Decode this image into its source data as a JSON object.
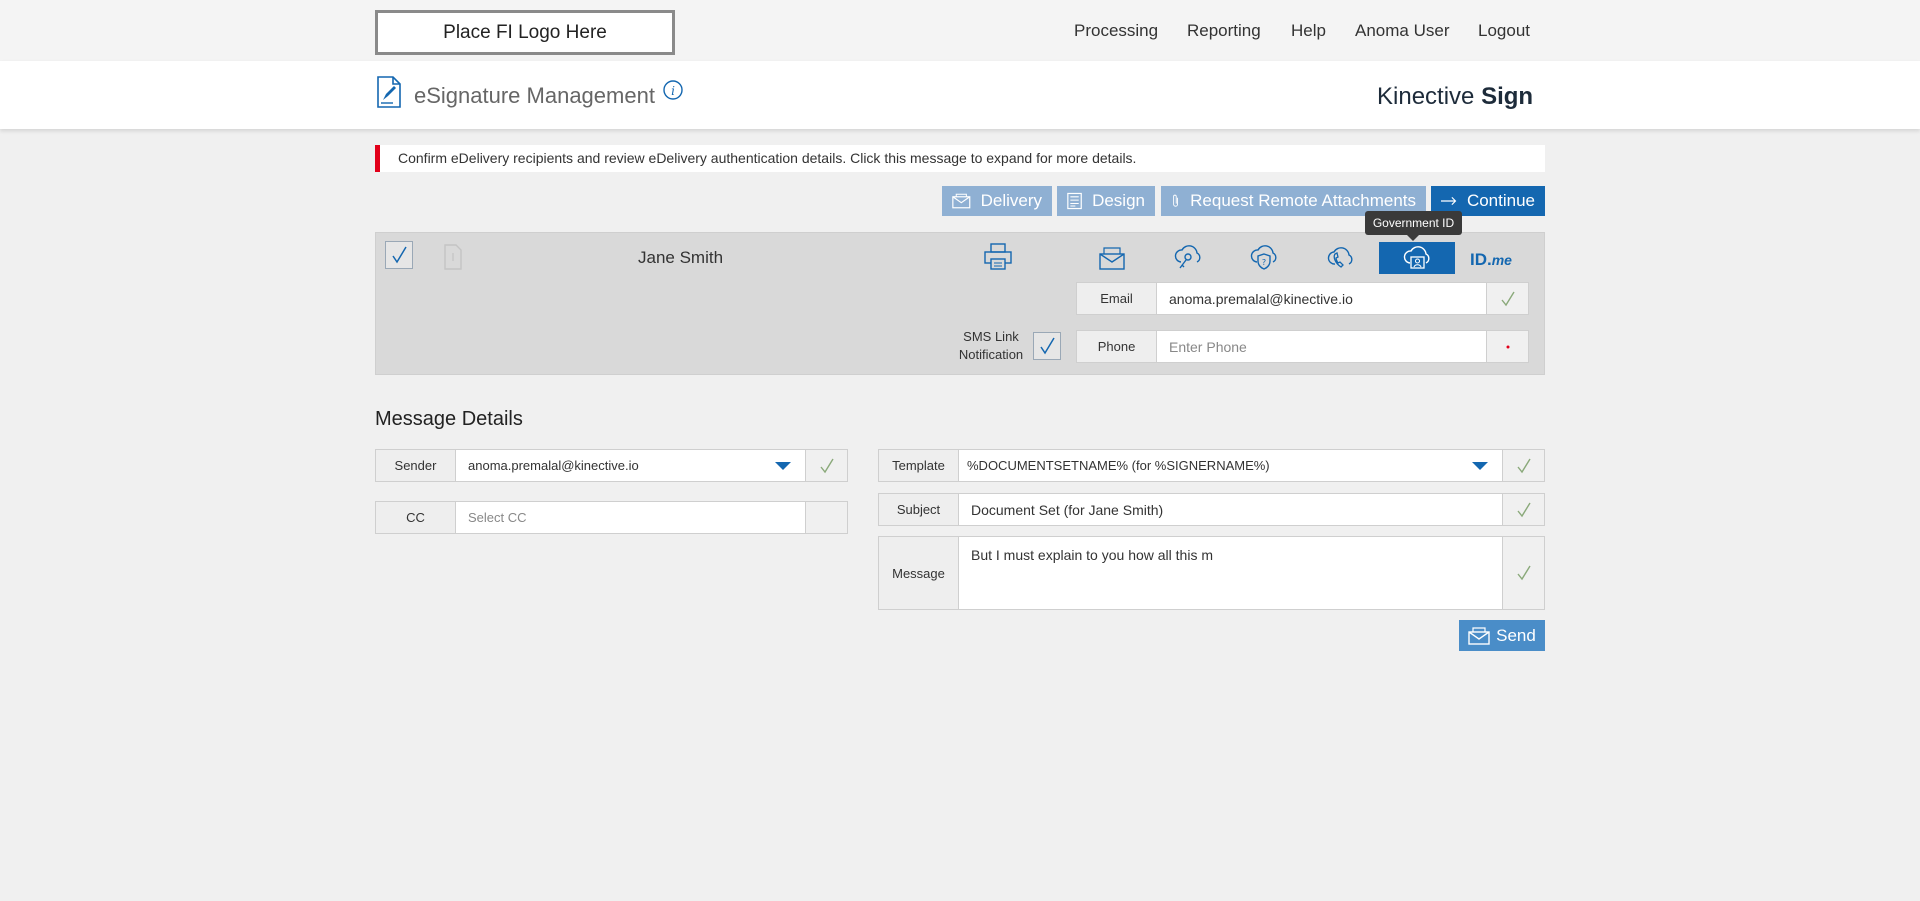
{
  "topbar": {
    "logo_text": "Place FI Logo Here",
    "nav": [
      "Processing",
      "Reporting",
      "Help",
      "Anoma User",
      "Logout"
    ]
  },
  "header": {
    "title": "eSignature Management",
    "brand_light": "Kinective ",
    "brand_bold": "Sign"
  },
  "banner": {
    "text": "Confirm eDelivery recipients and review eDelivery authentication details. Click this message to expand for more details."
  },
  "toolbar": {
    "delivery": "Delivery",
    "design": "Design",
    "attachments": "Request Remote Attachments",
    "continue": "Continue"
  },
  "recipient": {
    "name": "Jane Smith",
    "tooltip": "Government ID",
    "idme_main": "ID.",
    "idme_sub": "me",
    "sms_label": "SMS Link Notification",
    "email_label": "Email",
    "email_value": "anoma.premalal@kinective.io",
    "phone_label": "Phone",
    "phone_placeholder": "Enter Phone"
  },
  "message_details": {
    "title": "Message Details",
    "sender_label": "Sender",
    "sender_value": "anoma.premalal@kinective.io",
    "cc_label": "CC",
    "cc_placeholder": "Select CC",
    "template_label": "Template",
    "template_value": "%DOCUMENTSETNAME% (for %SIGNERNAME%)",
    "subject_label": "Subject",
    "subject_value": "Document Set (for Jane Smith)",
    "message_label": "Message",
    "message_value": "But I must explain to you how all this m",
    "send": "Send"
  },
  "colors": {
    "primary": "#1467b0",
    "toolbar_light": "#8fb0d3",
    "alert": "#e2001a",
    "check_green": "#8aa97a"
  }
}
